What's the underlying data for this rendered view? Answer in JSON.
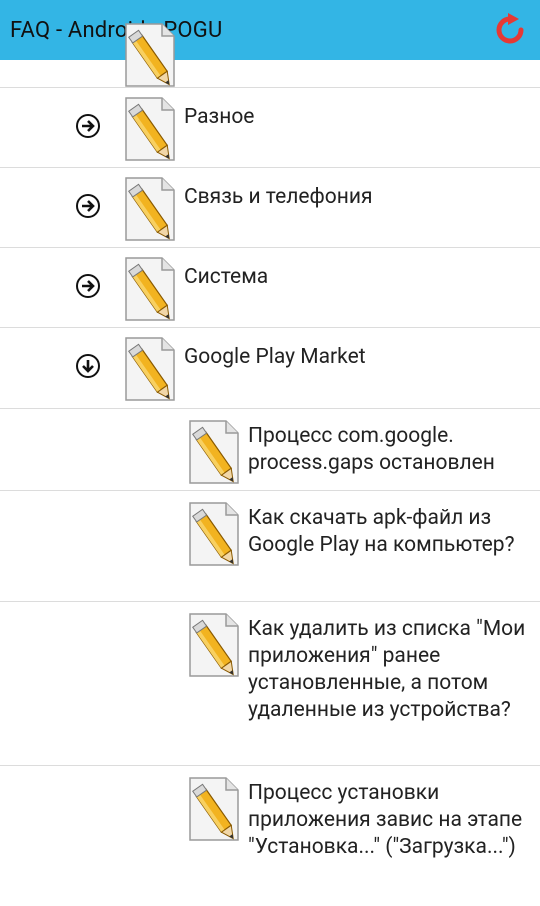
{
  "app": {
    "title": "FAQ - Android - POGU"
  },
  "toolbar": {
    "refresh_icon": "refresh-icon"
  },
  "categories": [
    {
      "label": "Разное",
      "expanded": false
    },
    {
      "label": "Связь и телефония",
      "expanded": false
    },
    {
      "label": "Система",
      "expanded": false
    },
    {
      "label": "Google Play Market",
      "expanded": true
    }
  ],
  "children": [
    {
      "label": "Процесс com.google. process.gaps остановлен"
    },
    {
      "label": "Как скачать apk-файл из Google Play на компьютер?"
    },
    {
      "label": "Как удалить из списка \"Мои приложения\" ранее установленные, а потом удаленные из устройства?"
    },
    {
      "label": "Процесс установки приложения завис на этапе \"Установка...\" (\"Загрузка...\")"
    }
  ],
  "colors": {
    "appbar": "#33b5e5",
    "refresh": "#e53935"
  }
}
